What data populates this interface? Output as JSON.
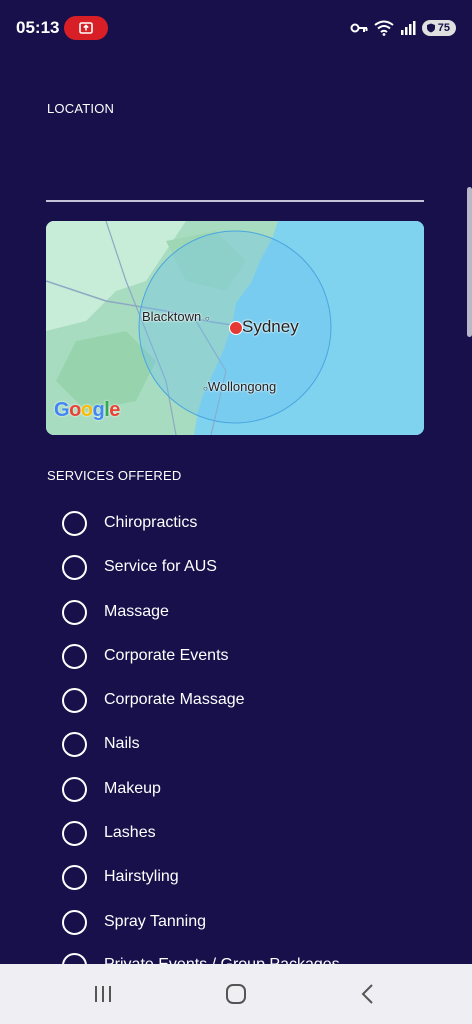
{
  "status_bar": {
    "time": "05:13",
    "battery": "75",
    "icons": [
      "screen-record-icon",
      "vpn-key-icon",
      "wifi-icon",
      "signal-icon",
      "battery-icon"
    ]
  },
  "location": {
    "label": "LOCATION",
    "value": "",
    "map": {
      "labels": {
        "primary": "Sydney",
        "suburb1": "Blacktown",
        "suburb2": "Wollongong"
      },
      "provider": "Google"
    }
  },
  "services": {
    "label": "SERVICES OFFERED",
    "items": [
      "Chiropractics",
      "Service for AUS",
      "Massage",
      "Corporate Events",
      "Corporate Massage",
      "Nails",
      "Makeup",
      "Lashes",
      "Hairstyling",
      "Spray Tanning",
      "Private Events / Group Packages"
    ]
  },
  "colors": {
    "background": "#17104a",
    "text": "#ffffff",
    "map_water": "#7fd3ef",
    "pin": "#e53935"
  }
}
